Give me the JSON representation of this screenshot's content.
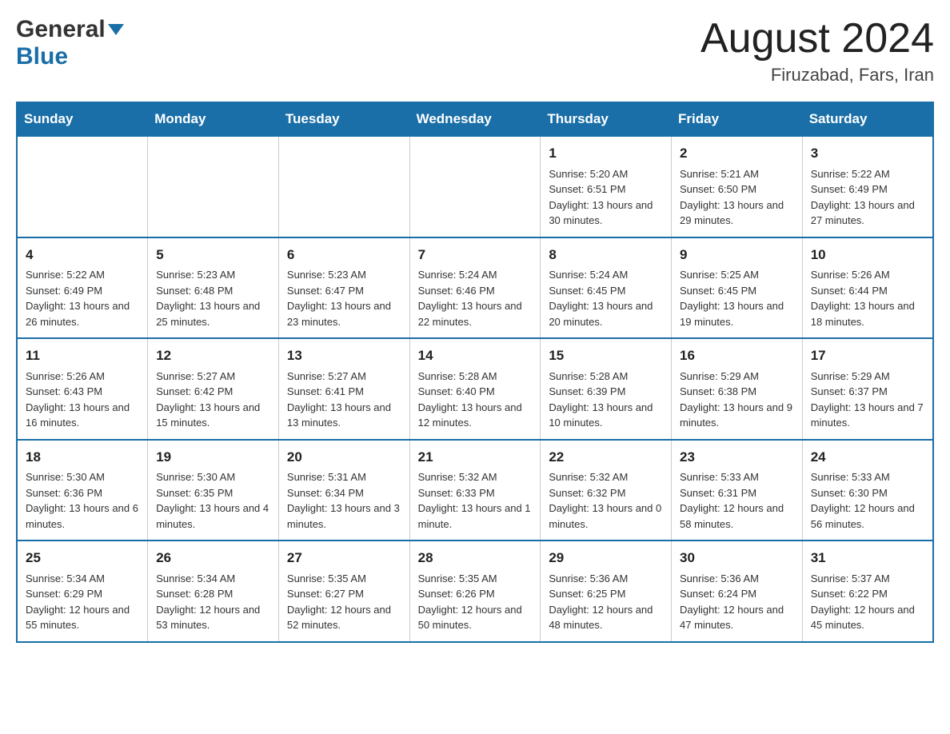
{
  "header": {
    "logo_general": "General",
    "logo_blue": "Blue",
    "month_year": "August 2024",
    "location": "Firuzabad, Fars, Iran"
  },
  "weekdays": [
    "Sunday",
    "Monday",
    "Tuesday",
    "Wednesday",
    "Thursday",
    "Friday",
    "Saturday"
  ],
  "weeks": [
    [
      {
        "day": "",
        "sunrise": "",
        "sunset": "",
        "daylight": ""
      },
      {
        "day": "",
        "sunrise": "",
        "sunset": "",
        "daylight": ""
      },
      {
        "day": "",
        "sunrise": "",
        "sunset": "",
        "daylight": ""
      },
      {
        "day": "",
        "sunrise": "",
        "sunset": "",
        "daylight": ""
      },
      {
        "day": "1",
        "sunrise": "Sunrise: 5:20 AM",
        "sunset": "Sunset: 6:51 PM",
        "daylight": "Daylight: 13 hours and 30 minutes."
      },
      {
        "day": "2",
        "sunrise": "Sunrise: 5:21 AM",
        "sunset": "Sunset: 6:50 PM",
        "daylight": "Daylight: 13 hours and 29 minutes."
      },
      {
        "day": "3",
        "sunrise": "Sunrise: 5:22 AM",
        "sunset": "Sunset: 6:49 PM",
        "daylight": "Daylight: 13 hours and 27 minutes."
      }
    ],
    [
      {
        "day": "4",
        "sunrise": "Sunrise: 5:22 AM",
        "sunset": "Sunset: 6:49 PM",
        "daylight": "Daylight: 13 hours and 26 minutes."
      },
      {
        "day": "5",
        "sunrise": "Sunrise: 5:23 AM",
        "sunset": "Sunset: 6:48 PM",
        "daylight": "Daylight: 13 hours and 25 minutes."
      },
      {
        "day": "6",
        "sunrise": "Sunrise: 5:23 AM",
        "sunset": "Sunset: 6:47 PM",
        "daylight": "Daylight: 13 hours and 23 minutes."
      },
      {
        "day": "7",
        "sunrise": "Sunrise: 5:24 AM",
        "sunset": "Sunset: 6:46 PM",
        "daylight": "Daylight: 13 hours and 22 minutes."
      },
      {
        "day": "8",
        "sunrise": "Sunrise: 5:24 AM",
        "sunset": "Sunset: 6:45 PM",
        "daylight": "Daylight: 13 hours and 20 minutes."
      },
      {
        "day": "9",
        "sunrise": "Sunrise: 5:25 AM",
        "sunset": "Sunset: 6:45 PM",
        "daylight": "Daylight: 13 hours and 19 minutes."
      },
      {
        "day": "10",
        "sunrise": "Sunrise: 5:26 AM",
        "sunset": "Sunset: 6:44 PM",
        "daylight": "Daylight: 13 hours and 18 minutes."
      }
    ],
    [
      {
        "day": "11",
        "sunrise": "Sunrise: 5:26 AM",
        "sunset": "Sunset: 6:43 PM",
        "daylight": "Daylight: 13 hours and 16 minutes."
      },
      {
        "day": "12",
        "sunrise": "Sunrise: 5:27 AM",
        "sunset": "Sunset: 6:42 PM",
        "daylight": "Daylight: 13 hours and 15 minutes."
      },
      {
        "day": "13",
        "sunrise": "Sunrise: 5:27 AM",
        "sunset": "Sunset: 6:41 PM",
        "daylight": "Daylight: 13 hours and 13 minutes."
      },
      {
        "day": "14",
        "sunrise": "Sunrise: 5:28 AM",
        "sunset": "Sunset: 6:40 PM",
        "daylight": "Daylight: 13 hours and 12 minutes."
      },
      {
        "day": "15",
        "sunrise": "Sunrise: 5:28 AM",
        "sunset": "Sunset: 6:39 PM",
        "daylight": "Daylight: 13 hours and 10 minutes."
      },
      {
        "day": "16",
        "sunrise": "Sunrise: 5:29 AM",
        "sunset": "Sunset: 6:38 PM",
        "daylight": "Daylight: 13 hours and 9 minutes."
      },
      {
        "day": "17",
        "sunrise": "Sunrise: 5:29 AM",
        "sunset": "Sunset: 6:37 PM",
        "daylight": "Daylight: 13 hours and 7 minutes."
      }
    ],
    [
      {
        "day": "18",
        "sunrise": "Sunrise: 5:30 AM",
        "sunset": "Sunset: 6:36 PM",
        "daylight": "Daylight: 13 hours and 6 minutes."
      },
      {
        "day": "19",
        "sunrise": "Sunrise: 5:30 AM",
        "sunset": "Sunset: 6:35 PM",
        "daylight": "Daylight: 13 hours and 4 minutes."
      },
      {
        "day": "20",
        "sunrise": "Sunrise: 5:31 AM",
        "sunset": "Sunset: 6:34 PM",
        "daylight": "Daylight: 13 hours and 3 minutes."
      },
      {
        "day": "21",
        "sunrise": "Sunrise: 5:32 AM",
        "sunset": "Sunset: 6:33 PM",
        "daylight": "Daylight: 13 hours and 1 minute."
      },
      {
        "day": "22",
        "sunrise": "Sunrise: 5:32 AM",
        "sunset": "Sunset: 6:32 PM",
        "daylight": "Daylight: 13 hours and 0 minutes."
      },
      {
        "day": "23",
        "sunrise": "Sunrise: 5:33 AM",
        "sunset": "Sunset: 6:31 PM",
        "daylight": "Daylight: 12 hours and 58 minutes."
      },
      {
        "day": "24",
        "sunrise": "Sunrise: 5:33 AM",
        "sunset": "Sunset: 6:30 PM",
        "daylight": "Daylight: 12 hours and 56 minutes."
      }
    ],
    [
      {
        "day": "25",
        "sunrise": "Sunrise: 5:34 AM",
        "sunset": "Sunset: 6:29 PM",
        "daylight": "Daylight: 12 hours and 55 minutes."
      },
      {
        "day": "26",
        "sunrise": "Sunrise: 5:34 AM",
        "sunset": "Sunset: 6:28 PM",
        "daylight": "Daylight: 12 hours and 53 minutes."
      },
      {
        "day": "27",
        "sunrise": "Sunrise: 5:35 AM",
        "sunset": "Sunset: 6:27 PM",
        "daylight": "Daylight: 12 hours and 52 minutes."
      },
      {
        "day": "28",
        "sunrise": "Sunrise: 5:35 AM",
        "sunset": "Sunset: 6:26 PM",
        "daylight": "Daylight: 12 hours and 50 minutes."
      },
      {
        "day": "29",
        "sunrise": "Sunrise: 5:36 AM",
        "sunset": "Sunset: 6:25 PM",
        "daylight": "Daylight: 12 hours and 48 minutes."
      },
      {
        "day": "30",
        "sunrise": "Sunrise: 5:36 AM",
        "sunset": "Sunset: 6:24 PM",
        "daylight": "Daylight: 12 hours and 47 minutes."
      },
      {
        "day": "31",
        "sunrise": "Sunrise: 5:37 AM",
        "sunset": "Sunset: 6:22 PM",
        "daylight": "Daylight: 12 hours and 45 minutes."
      }
    ]
  ]
}
